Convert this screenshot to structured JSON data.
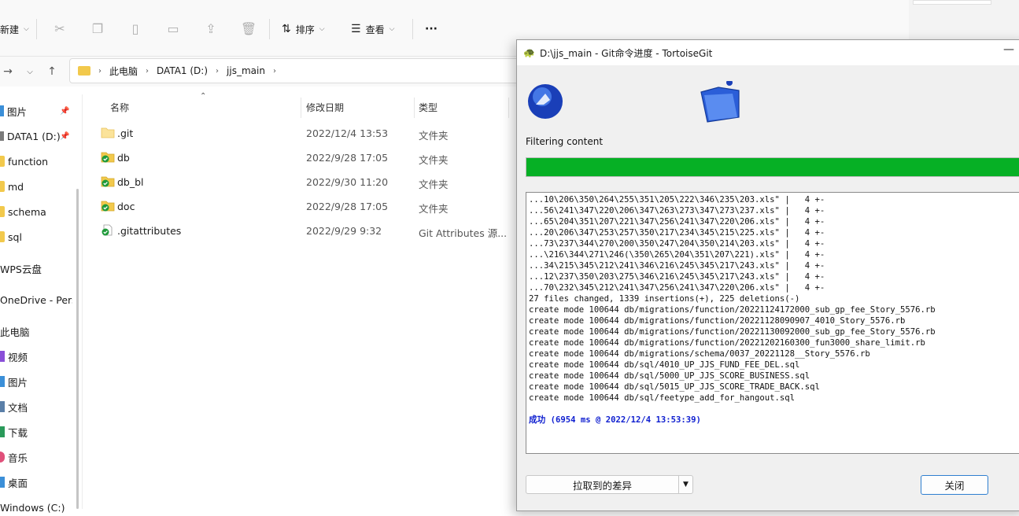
{
  "explorer": {
    "toolbar": {
      "new_label": "新建",
      "sort_label": "排序",
      "view_label": "查看",
      "more_label": "···"
    },
    "breadcrumb": [
      "此电脑",
      "DATA1 (D:)",
      "jjs_main"
    ],
    "nav": {
      "items": [
        {
          "label": "图片"
        },
        {
          "label": "DATA1 (D:)"
        },
        {
          "label": "function"
        },
        {
          "label": "md"
        },
        {
          "label": "schema"
        },
        {
          "label": "sql"
        },
        {
          "label": "WPS云盘"
        },
        {
          "label": "OneDrive - Pers"
        },
        {
          "label": "此电脑"
        },
        {
          "label": "视频"
        },
        {
          "label": "图片"
        },
        {
          "label": "文档"
        },
        {
          "label": "下载"
        },
        {
          "label": "音乐"
        },
        {
          "label": "桌面"
        },
        {
          "label": "Windows (C:)"
        }
      ]
    },
    "columns": {
      "name": "名称",
      "modified": "修改日期",
      "type": "类型"
    },
    "files": [
      {
        "name": ".git",
        "modified": "2022/12/4 13:53",
        "type": "文件夹"
      },
      {
        "name": "db",
        "modified": "2022/9/28 17:05",
        "type": "文件夹"
      },
      {
        "name": "db_bl",
        "modified": "2022/9/30 11:20",
        "type": "文件夹"
      },
      {
        "name": "doc",
        "modified": "2022/9/28 17:05",
        "type": "文件夹"
      },
      {
        "name": ".gitattributes",
        "modified": "2022/9/29 9:32",
        "type": "Git Attributes 源..."
      }
    ]
  },
  "dialog": {
    "title": "D:\\jjs_main - Git命令进度 - TortoiseGit",
    "status": "Filtering content",
    "progress": 1.0,
    "progress_color": "#06b025",
    "log_lines": [
      "...10\\206\\350\\264\\255\\351\\205\\222\\346\\235\\203.xls\" |   4 +-",
      "...56\\241\\347\\220\\206\\347\\263\\273\\347\\273\\237.xls\" |   4 +-",
      "...65\\204\\351\\207\\221\\347\\256\\241\\347\\220\\206.xls\" |   4 +-",
      "...20\\206\\347\\253\\257\\350\\217\\234\\345\\215\\225.xls\" |   4 +-",
      "...73\\237\\344\\270\\200\\350\\247\\204\\350\\214\\203.xls\" |   4 +-",
      "...\\216\\344\\271\\246(\\350\\265\\204\\351\\207\\221).xls\" |   4 +-",
      "...34\\215\\345\\212\\241\\346\\216\\245\\345\\217\\243.xls\" |   4 +-",
      "...12\\237\\350\\203\\275\\346\\216\\245\\345\\217\\243.xls\" |   4 +-",
      "...70\\232\\345\\212\\241\\347\\256\\241\\347\\220\\206.xls\" |   4 +-",
      "27 files changed, 1339 insertions(+), 225 deletions(-)",
      "create mode 100644 db/migrations/function/20221124172000_sub_gp_fee_Story_5576.rb",
      "create mode 100644 db/migrations/function/20221128090907_4010_Story_5576.rb",
      "create mode 100644 db/migrations/function/20221130092000_sub_gp_fee_Story_5576.rb",
      "create mode 100644 db/migrations/function/20221202160300_fun3000_share_limit.rb",
      "create mode 100644 db/migrations/schema/0037_20221128__Story_5576.rb",
      "create mode 100644 db/sql/4010_UP_JJS_FUND_FEE_DEL.sql",
      "create mode 100644 db/sql/5000_UP_JJS_SCORE_BUSINESS.sql",
      "create mode 100644 db/sql/5015_UP_JJS_SCORE_TRADE_BACK.sql",
      "create mode 100644 db/sql/feetype_add_for_hangout.sql"
    ],
    "success_line": "成功 (6954 ms @ 2022/12/4 13:53:39)",
    "diff_button": "拉取到的差异",
    "close_button": "关闭"
  }
}
